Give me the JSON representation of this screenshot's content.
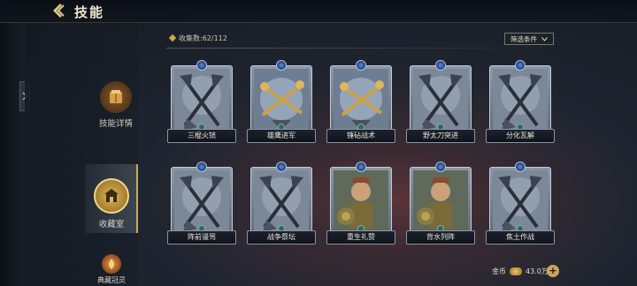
{
  "header": {
    "title": "技能"
  },
  "sidebar": {
    "items": [
      {
        "label": "技能详情",
        "icon": "skill-book-icon"
      },
      {
        "label": "收藏室",
        "icon": "vault-icon"
      },
      {
        "label": "典藏冠灵",
        "icon": "spirit-icon"
      }
    ]
  },
  "collection": {
    "label": "收集数:62/112",
    "filter_label": "筛选条件"
  },
  "cards": [
    {
      "name": "三棍火铳",
      "art": "axes"
    },
    {
      "name": "雄鹰进军",
      "art": "keys"
    },
    {
      "name": "锤砧战术",
      "art": "keys"
    },
    {
      "name": "野太刀突进",
      "art": "axes"
    },
    {
      "name": "分化瓦解",
      "art": "axes"
    },
    {
      "name": "阵前谩骂",
      "art": "axes"
    },
    {
      "name": "战争祭坛",
      "art": "axes"
    },
    {
      "name": "重生礼赞",
      "art": "warrior"
    },
    {
      "name": "背水列阵",
      "art": "warrior"
    },
    {
      "name": "焦土作战",
      "art": "axes"
    }
  ],
  "currency": {
    "label": "金币",
    "value": "43.0万",
    "add_label": "+"
  },
  "colors": {
    "accent": "#c9a75a",
    "card_frame": "#c6ccd4",
    "gem_blue": "#3f6ec8"
  }
}
